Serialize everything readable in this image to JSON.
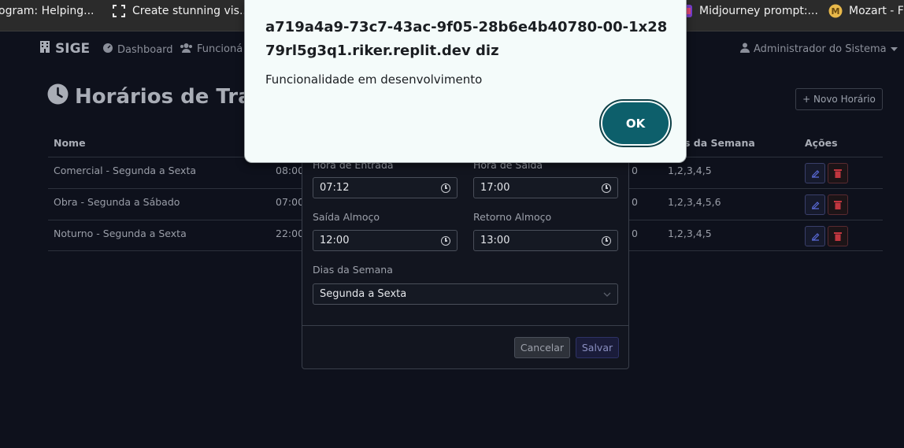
{
  "bookmarks": [
    {
      "label": "ogram: Helping...",
      "icon": "none"
    },
    {
      "label": "Create stunning vis...",
      "icon": "frame-icon"
    },
    {
      "label": "Midjourney prompt:...",
      "icon": "midjourney-icon"
    },
    {
      "label": "Mozart - F",
      "icon": "mozart-icon"
    }
  ],
  "nav": {
    "brand": "SIGE",
    "dashboard": "Dashboard",
    "funcionarios": "Funcioná",
    "user": "Administrador do Sistema"
  },
  "page": {
    "title": "Horários de Traba",
    "new_button": "+ Novo Horário"
  },
  "table": {
    "headers": {
      "nome": "Nome",
      "dias": "s da Semana",
      "acoes": "Ações"
    },
    "rows": [
      {
        "nome": "Comercial - Segunda a Sexta",
        "entrada": "08:00",
        "saida": "0",
        "dias": "1,2,3,4,5"
      },
      {
        "nome": "Obra - Segunda a Sábado",
        "entrada": "07:00",
        "saida": "0",
        "dias": "1,2,3,4,5,6"
      },
      {
        "nome": "Noturno - Segunda a Sexta",
        "entrada": "22:00",
        "saida": "0",
        "dias": "1,2,3,4,5"
      }
    ]
  },
  "modal": {
    "hora_entrada_label": "Hora de Entrada",
    "hora_entrada": "07:12",
    "hora_saida_label": "Hora de Saída",
    "hora_saida": "17:00",
    "saida_almoco_label": "Saída Almoço",
    "saida_almoco": "12:00",
    "retorno_almoco_label": "Retorno Almoço",
    "retorno_almoco": "13:00",
    "dias_label": "Dias da Semana",
    "dias_value": "Segunda a Sexta",
    "cancel": "Cancelar",
    "save": "Salvar"
  },
  "dialog": {
    "title": "a719a4a9-73c7-43ac-9f05-28b6e4b40780-00-1x2879rl5g3q1.riker.replit.dev diz",
    "message": "Funcionalidade em desenvolvimento",
    "ok": "OK"
  },
  "colors": {
    "ok_button": "#0d5f6b",
    "background": "#0e111c",
    "dialog_bg": "#f4fbfa"
  }
}
